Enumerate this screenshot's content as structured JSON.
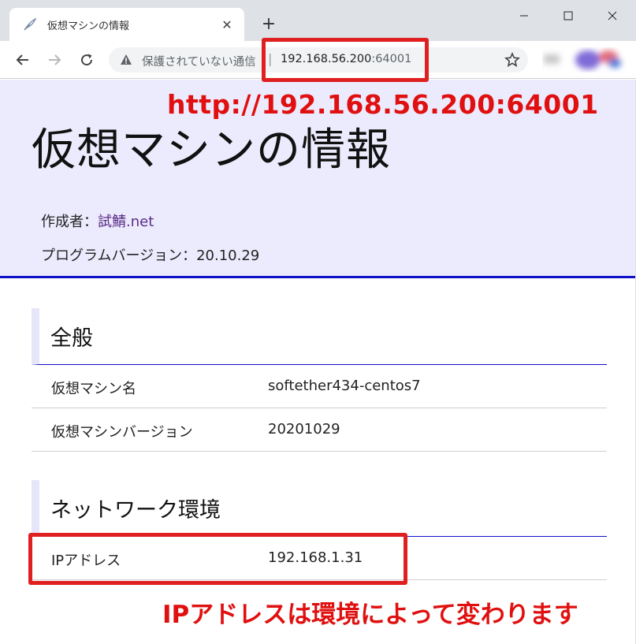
{
  "browser": {
    "tab_title": "仮想マシンの情報",
    "tab_close": "✕",
    "new_tab": "+",
    "insecure_label": "保護されていない通信",
    "url_host": "192.168.56.200",
    "url_port": ":64001"
  },
  "page": {
    "title": "仮想マシンの情報",
    "author_label": "作成者：",
    "author_link": "試鯖.net",
    "version_line": "プログラムバージョン：20.10.29"
  },
  "sections": [
    {
      "heading": "全般",
      "rows": [
        {
          "key": "仮想マシン名",
          "value": "softether434-centos7"
        },
        {
          "key": "仮想マシンバージョン",
          "value": "20201029"
        }
      ]
    },
    {
      "heading": "ネットワーク環境",
      "rows": [
        {
          "key": "IPアドレス",
          "value": "192.168.1.31"
        }
      ]
    }
  ],
  "annotations": {
    "url_callout": "http://192.168.56.200:64001",
    "ip_callout": "IPアドレスは環境によって変わります",
    "color": "#e01010"
  }
}
